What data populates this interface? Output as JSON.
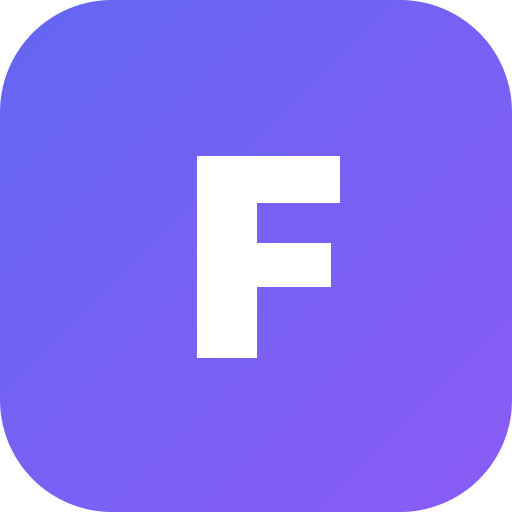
{
  "icon": {
    "letter": "F",
    "gradient_start": "#6366f1",
    "gradient_end": "#8b5cf6",
    "letter_color": "#ffffff"
  }
}
